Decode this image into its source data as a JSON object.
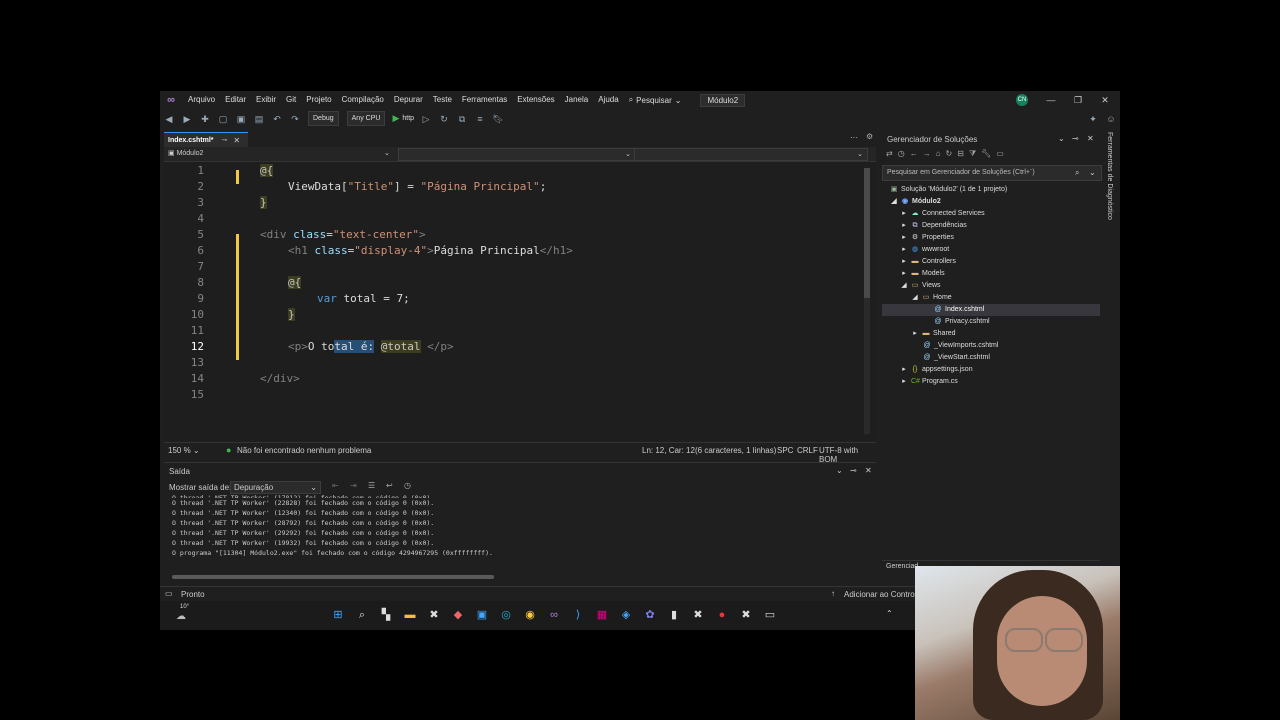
{
  "app": {
    "logo_icon": "visual-studio-logo-icon",
    "project_name": "Módulo2",
    "user_initials": "CN"
  },
  "menu": [
    "Arquivo",
    "Editar",
    "Exibir",
    "Git",
    "Projeto",
    "Compilação",
    "Depurar",
    "Teste",
    "Ferramentas",
    "Extensões",
    "Janela",
    "Ajuda"
  ],
  "search_label": "Pesquisar",
  "toolbar": {
    "config": "Debug",
    "platform": "Any CPU",
    "run_label": "http"
  },
  "editor": {
    "tab_label": "Index.cshtml*",
    "nav_left": "Módulo2",
    "zoom": "150 %",
    "status_message": "Não foi encontrado nenhum problema",
    "cursor_info": "Ln: 12, Car: 12",
    "selection_info": "(6 caracteres, 1 linhas)",
    "whitespace": "SPC",
    "line_ending": "CRLF",
    "encoding": "UTF-8 with BOM",
    "line_numbers": [
      "1",
      "2",
      "3",
      "4",
      "5",
      "6",
      "7",
      "8",
      "9",
      "10",
      "11",
      "12",
      "13",
      "14",
      "15"
    ],
    "lines": {
      "l1": "@{",
      "l2a": "ViewData[",
      "l2b": "\"Title\"",
      "l2c": "] = ",
      "l2d": "\"Página Principal\"",
      "l2e": ";",
      "l3": "}",
      "l5a": "<div ",
      "l5b": "class",
      "l5c": "=",
      "l5d": "\"text-center\"",
      "l5e": ">",
      "l6a": "<h1 ",
      "l6b": "class",
      "l6c": "=",
      "l6d": "\"display-4\"",
      "l6e": ">",
      "l6f": "Página Principal",
      "l6g": "</h1>",
      "l8": "@{",
      "l9a": "var",
      "l9b": " total = 7;",
      "l10": "}",
      "l12a": "<p>",
      "l12b": "O to",
      "l12c": "tal é:",
      "l12d": " ",
      "l12e": "@total",
      "l12f": " ",
      "l12g": "</p>",
      "l14": "</div>"
    }
  },
  "output": {
    "title": "Saída",
    "show_label": "Mostrar saída de:",
    "source": "Depuração",
    "lines": [
      "O thread '.NET TP Worker' (17812) foi fechado com o código 0 (0x0).",
      "O thread '.NET TP Worker' (22828) foi fechado com o código 0 (0x0).",
      "O thread '.NET TP Worker' (12340) foi fechado com o código 0 (0x0).",
      "O thread '.NET TP Worker' (28792) foi fechado com o código 0 (0x0).",
      "O thread '.NET TP Worker' (29292) foi fechado com o código 0 (0x0).",
      "O thread '.NET TP Worker' (19932) foi fechado com o código 0 (0x0).",
      "O programa \"[11304] Módulo2.exe\" foi fechado com o código 4294967295 (0xffffffff)."
    ]
  },
  "solution": {
    "title": "Gerenciador de Soluções",
    "search_placeholder": "Pesquisar em Gerenciador de Soluções (Ctrl+¨)",
    "side_tab": "Ferramentas de Diagnóstico",
    "items": [
      {
        "label": "Solução 'Módulo2' (1 de 1 projeto)"
      },
      {
        "label": "Módulo2"
      },
      {
        "label": "Connected Services"
      },
      {
        "label": "Dependências"
      },
      {
        "label": "Properties"
      },
      {
        "label": "wwwroot"
      },
      {
        "label": "Controllers"
      },
      {
        "label": "Models"
      },
      {
        "label": "Views"
      },
      {
        "label": "Home"
      },
      {
        "label": "Index.cshtml"
      },
      {
        "label": "Privacy.cshtml"
      },
      {
        "label": "Shared"
      },
      {
        "label": "_ViewImports.cshtml"
      },
      {
        "label": "_ViewStart.cshtml"
      },
      {
        "label": "appsettings.json"
      },
      {
        "label": "Program.cs"
      }
    ],
    "bottom_tab": "Gerenciad"
  },
  "statusbar": {
    "ready": "Pronto",
    "add_source": "Adicionar ao Controle"
  },
  "taskbar": {
    "weather": "10°"
  }
}
